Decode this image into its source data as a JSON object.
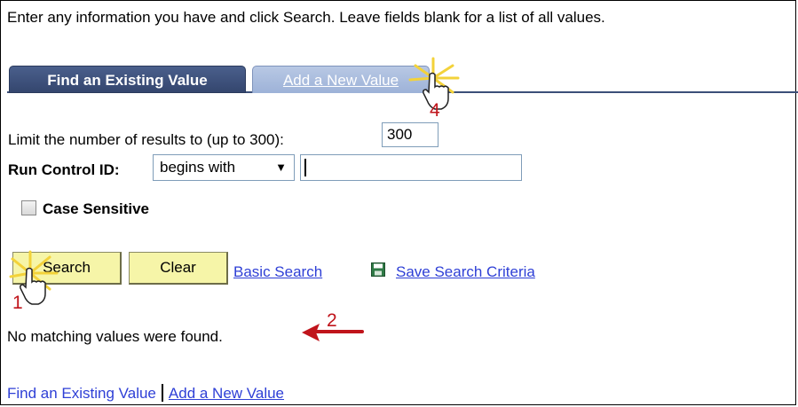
{
  "instructions": "Enter any information you have and click Search. Leave fields blank for a list of all values.",
  "tabs": [
    {
      "label": "Find an Existing Value",
      "active": true
    },
    {
      "label": "Add a New Value",
      "active": false
    }
  ],
  "form": {
    "limit_label": "Limit the number of results to (up to 300):",
    "limit_value": "300",
    "run_control_label": "Run Control ID:",
    "operator": "begins with",
    "run_control_value": "",
    "case_sensitive_label": "Case Sensitive",
    "case_sensitive_checked": false
  },
  "buttons": {
    "search": "Search",
    "clear": "Clear"
  },
  "links": {
    "basic_search": "Basic Search",
    "save_search_criteria": "Save Search Criteria"
  },
  "status_message": "No matching values were found.",
  "bottom_links": [
    {
      "label": "Find an Existing Value",
      "underlined": false
    },
    {
      "label": "Add a New Value",
      "underlined": true
    }
  ],
  "callouts": [
    "1",
    "2",
    "4"
  ],
  "colors": {
    "tab_active": "#3f527c",
    "tab_inactive": "#a9bcdf",
    "button_bg": "#f6f5a8",
    "link": "#2e3fd6",
    "callout": "#c0141b",
    "highlight": "#f3d23a"
  },
  "icons": {
    "save": "save-icon",
    "pointer": "hand-pointer-icon",
    "arrow": "arrow-left-icon",
    "dropdown": "chevron-down-icon"
  }
}
